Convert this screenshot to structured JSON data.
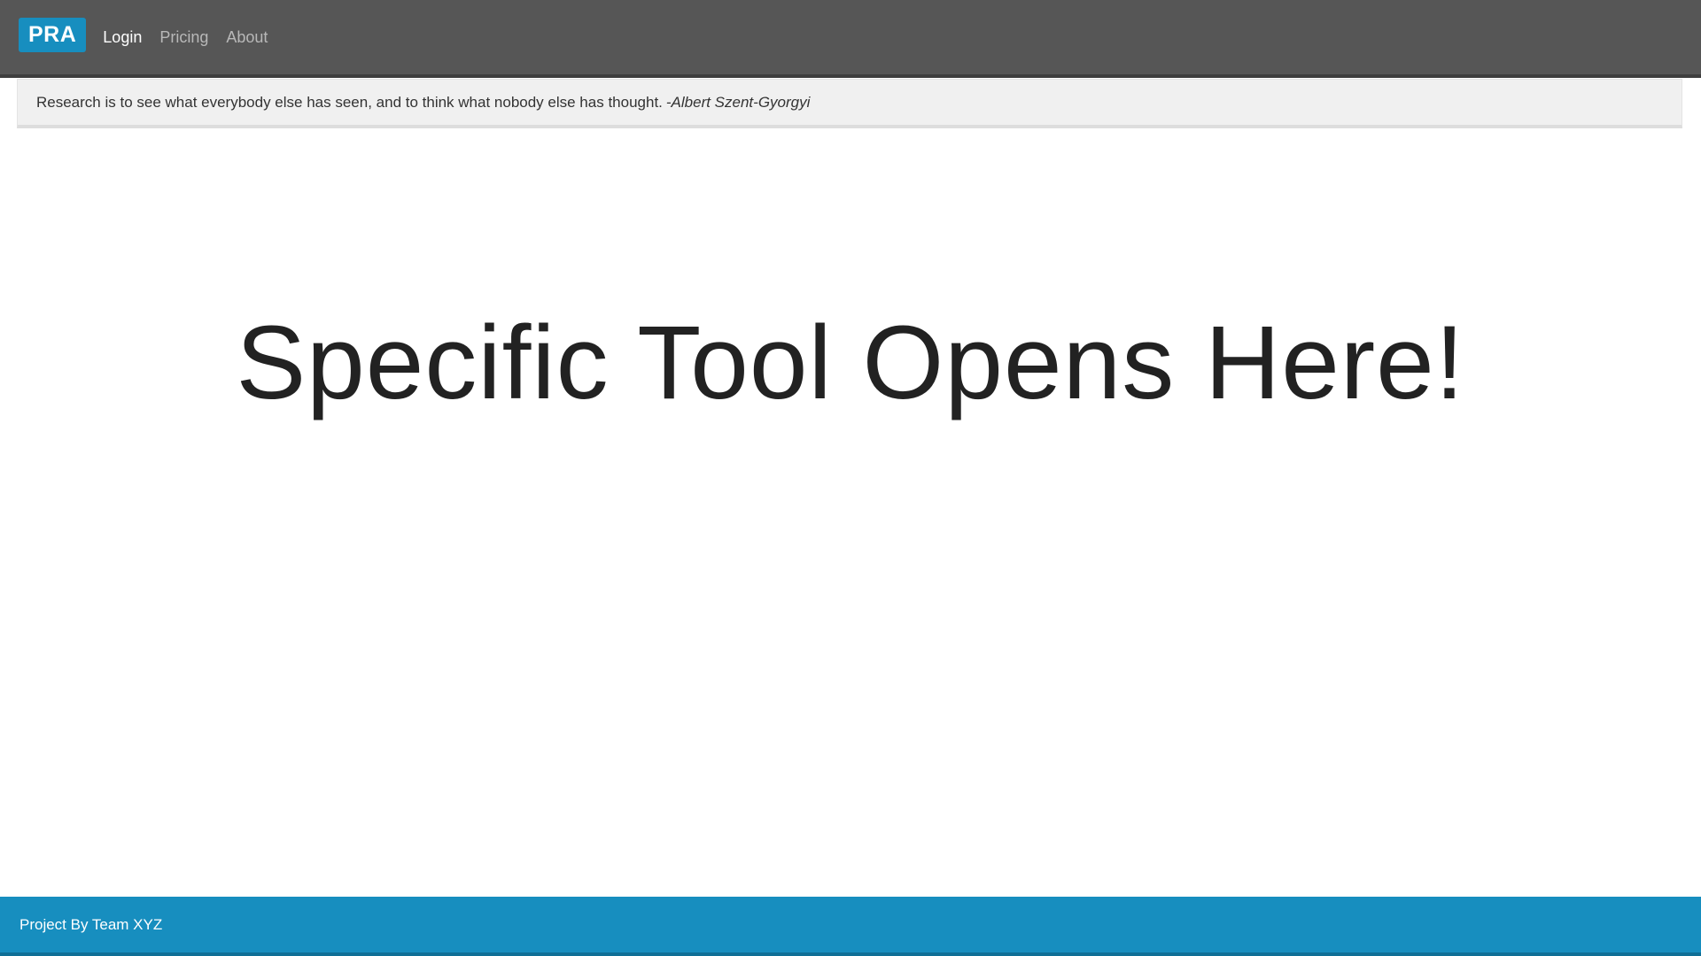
{
  "colors": {
    "brand": "#178ebf",
    "navbar": "#565656",
    "footer": "#178ebf"
  },
  "navbar": {
    "brand_label": "PRA",
    "links": [
      {
        "label": "Login",
        "active": true
      },
      {
        "label": "Pricing",
        "active": false
      },
      {
        "label": "About",
        "active": false
      }
    ]
  },
  "quote": {
    "text": "Research is to see what everybody else has seen, and to think what nobody else has thought.",
    "author": "-Albert Szent-Gyorgyi"
  },
  "main": {
    "headline": "Specific Tool Opens Here!"
  },
  "footer": {
    "text": "Project By Team XYZ"
  }
}
